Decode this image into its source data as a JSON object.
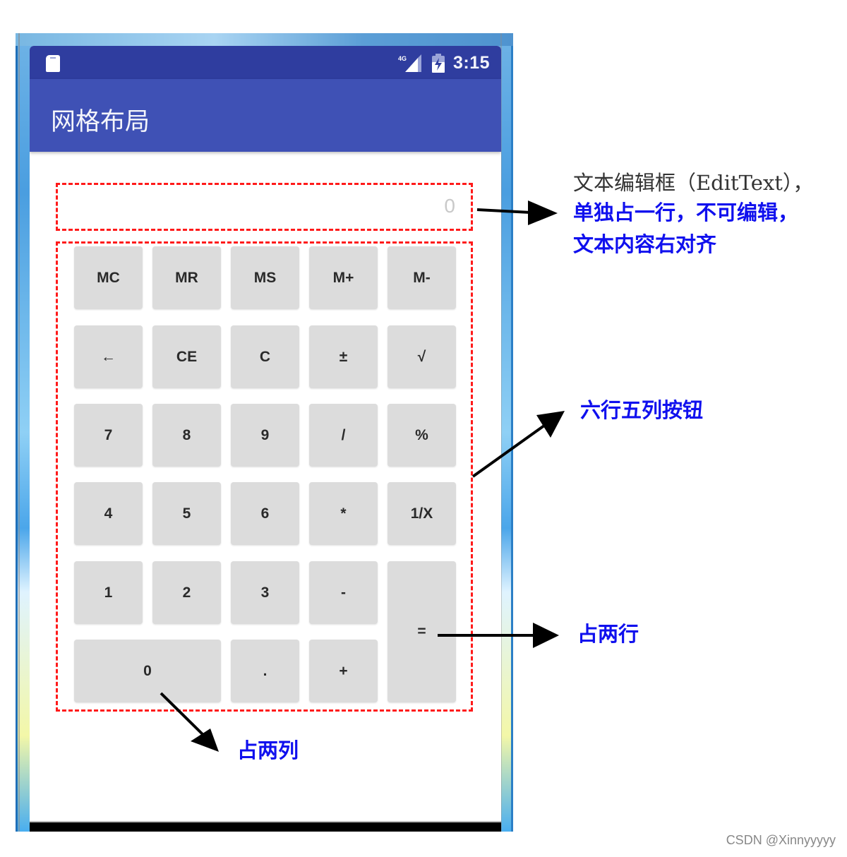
{
  "status_bar": {
    "left_icon": "sd-card-icon",
    "network_label": "4G",
    "icons": [
      "signal-4g-icon",
      "battery-charging-icon"
    ],
    "time": "3:15"
  },
  "app_bar": {
    "title": "网格布局"
  },
  "edit_text": {
    "value": "0",
    "alignment": "right",
    "editable": false
  },
  "buttons": [
    {
      "label": "MC",
      "row": 1,
      "col": 1,
      "rowspan": 1,
      "colspan": 1
    },
    {
      "label": "MR",
      "row": 1,
      "col": 2,
      "rowspan": 1,
      "colspan": 1
    },
    {
      "label": "MS",
      "row": 1,
      "col": 3,
      "rowspan": 1,
      "colspan": 1
    },
    {
      "label": "M+",
      "row": 1,
      "col": 4,
      "rowspan": 1,
      "colspan": 1
    },
    {
      "label": "M-",
      "row": 1,
      "col": 5,
      "rowspan": 1,
      "colspan": 1
    },
    {
      "label": "←",
      "row": 2,
      "col": 1,
      "rowspan": 1,
      "colspan": 1
    },
    {
      "label": "CE",
      "row": 2,
      "col": 2,
      "rowspan": 1,
      "colspan": 1
    },
    {
      "label": "C",
      "row": 2,
      "col": 3,
      "rowspan": 1,
      "colspan": 1
    },
    {
      "label": "±",
      "row": 2,
      "col": 4,
      "rowspan": 1,
      "colspan": 1
    },
    {
      "label": "√",
      "row": 2,
      "col": 5,
      "rowspan": 1,
      "colspan": 1
    },
    {
      "label": "7",
      "row": 3,
      "col": 1,
      "rowspan": 1,
      "colspan": 1
    },
    {
      "label": "8",
      "row": 3,
      "col": 2,
      "rowspan": 1,
      "colspan": 1
    },
    {
      "label": "9",
      "row": 3,
      "col": 3,
      "rowspan": 1,
      "colspan": 1
    },
    {
      "label": "/",
      "row": 3,
      "col": 4,
      "rowspan": 1,
      "colspan": 1
    },
    {
      "label": "%",
      "row": 3,
      "col": 5,
      "rowspan": 1,
      "colspan": 1
    },
    {
      "label": "4",
      "row": 4,
      "col": 1,
      "rowspan": 1,
      "colspan": 1
    },
    {
      "label": "5",
      "row": 4,
      "col": 2,
      "rowspan": 1,
      "colspan": 1
    },
    {
      "label": "6",
      "row": 4,
      "col": 3,
      "rowspan": 1,
      "colspan": 1
    },
    {
      "label": "*",
      "row": 4,
      "col": 4,
      "rowspan": 1,
      "colspan": 1
    },
    {
      "label": "1/X",
      "row": 4,
      "col": 5,
      "rowspan": 1,
      "colspan": 1
    },
    {
      "label": "1",
      "row": 5,
      "col": 1,
      "rowspan": 1,
      "colspan": 1
    },
    {
      "label": "2",
      "row": 5,
      "col": 2,
      "rowspan": 1,
      "colspan": 1
    },
    {
      "label": "3",
      "row": 5,
      "col": 3,
      "rowspan": 1,
      "colspan": 1
    },
    {
      "label": "-",
      "row": 5,
      "col": 4,
      "rowspan": 1,
      "colspan": 1
    },
    {
      "label": "=",
      "row": 5,
      "col": 5,
      "rowspan": 2,
      "colspan": 1
    },
    {
      "label": "0",
      "row": 6,
      "col": 1,
      "rowspan": 1,
      "colspan": 2
    },
    {
      "label": ".",
      "row": 6,
      "col": 3,
      "rowspan": 1,
      "colspan": 1
    },
    {
      "label": "+",
      "row": 6,
      "col": 4,
      "rowspan": 1,
      "colspan": 1
    }
  ],
  "annotations": {
    "edit_text_line1": "文本编辑框（EditText），",
    "edit_text_line2": "单独占一行，不可编辑，",
    "edit_text_line3": "文本内容右对齐",
    "grid": "六行五列按钮",
    "equals_span": "占两行",
    "zero_span": "占两列"
  },
  "colors": {
    "status_bar": "#2f3d9f",
    "app_bar": "#3f51b5",
    "button_bg": "#dcdcdc",
    "dashed_outline": "#ff1a1a",
    "annotation_blue": "#1010ee"
  },
  "watermark": "CSDN @Xinnyyyyy"
}
